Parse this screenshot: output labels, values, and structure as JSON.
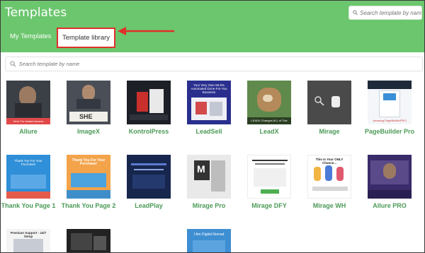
{
  "header": {
    "title": "Templates",
    "search_placeholder": "Search template by name"
  },
  "tabs": [
    {
      "label": "My Templates"
    },
    {
      "label": "Template library"
    }
  ],
  "library_search": {
    "placeholder": "Search template by name"
  },
  "templates": [
    {
      "name": "Allure",
      "thumb_text": "Here For Instant Access"
    },
    {
      "name": "ImageX",
      "thumb_text": "SHE"
    },
    {
      "name": "KontrolPress",
      "thumb_text": ""
    },
    {
      "name": "LeadSell",
      "thumb_text": "Your Very Own 58.8% Automated Done-For-You Business"
    },
    {
      "name": "LeadX",
      "thumb_text": "LEADX Changes ALL of This"
    },
    {
      "name": "Mirage",
      "thumb_text": ""
    },
    {
      "name": "PageBuilder Pro",
      "thumb_text": "Amazing PageBuilderPRO"
    },
    {
      "name": "Thank You Page 1",
      "thumb_text": "Thank You For Your Purchase!"
    },
    {
      "name": "Thank You Page 2",
      "thumb_text": "Thank You For Your Purchase!"
    },
    {
      "name": "LeadPlay",
      "thumb_text": ""
    },
    {
      "name": "Mirage Pro",
      "thumb_text": ""
    },
    {
      "name": "Mirage DFY",
      "thumb_text": ""
    },
    {
      "name": "Mirage WH",
      "thumb_text": "This Is Your ONLY Chance..."
    },
    {
      "name": "Allure PRO",
      "thumb_text": ""
    },
    {
      "name": "",
      "thumb_text": "Premium Support - 24/7 Setup"
    },
    {
      "name": "",
      "thumb_text": ""
    },
    {
      "name": "",
      "thumb_text": "I Am Digital Nomad"
    }
  ],
  "colors": {
    "header_green": "#6cc66e",
    "label_green": "#4b9a57",
    "highlight_red": "#e0302a"
  }
}
